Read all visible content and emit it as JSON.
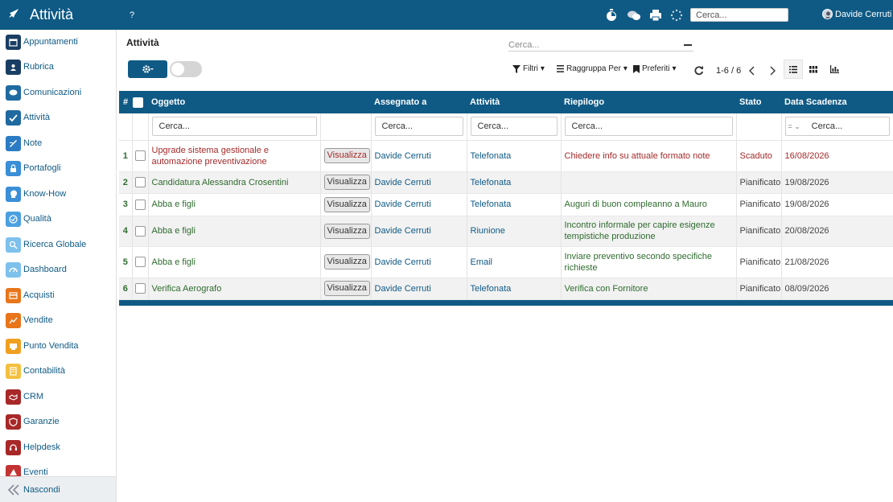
{
  "header": {
    "title": "Attività",
    "help": "?",
    "search_placeholder": "Cerca...",
    "user": "Davide Cerruti"
  },
  "sidebar": {
    "items": [
      {
        "label": "Appuntamenti",
        "icon": "calendar-icon",
        "color": "#1a3e63"
      },
      {
        "label": "Rubrica",
        "icon": "contact-icon",
        "color": "#1a3e63"
      },
      {
        "label": "Comunicazioni",
        "icon": "chat-icon",
        "color": "#1f6aa0"
      },
      {
        "label": "Attività",
        "icon": "check-icon",
        "color": "#1f6aa0"
      },
      {
        "label": "Note",
        "icon": "note-icon",
        "color": "#2b7cc4"
      },
      {
        "label": "Portafogli",
        "icon": "lock-icon",
        "color": "#3a8fd6"
      },
      {
        "label": "Know-How",
        "icon": "head-icon",
        "color": "#3a8fd6"
      },
      {
        "label": "Qualità",
        "icon": "quality-icon",
        "color": "#4aa0e0"
      },
      {
        "label": "Ricerca Globale",
        "icon": "search-icon",
        "color": "#7ec1ec"
      },
      {
        "label": "Dashboard",
        "icon": "dashboard-icon",
        "color": "#7ec1ec"
      },
      {
        "label": "Acquisti",
        "icon": "purchase-icon",
        "color": "#e8751a"
      },
      {
        "label": "Vendite",
        "icon": "sales-icon",
        "color": "#e8751a"
      },
      {
        "label": "Punto Vendita",
        "icon": "pos-icon",
        "color": "#f0a020"
      },
      {
        "label": "Contabilità",
        "icon": "accounting-icon",
        "color": "#f4c040"
      },
      {
        "label": "CRM",
        "icon": "crm-icon",
        "color": "#a82828"
      },
      {
        "label": "Garanzie",
        "icon": "shield-icon",
        "color": "#a82828"
      },
      {
        "label": "Helpdesk",
        "icon": "headset-icon",
        "color": "#a82828"
      },
      {
        "label": "Eventi",
        "icon": "event-icon",
        "color": "#c33333"
      }
    ],
    "footer_label": "Nascondi"
  },
  "main": {
    "title": "Attività",
    "search_placeholder": "Cerca...",
    "filters_label": "Filtri",
    "group_label": "Raggruppa Per",
    "favorites_label": "Preferiti",
    "pager": "1-6 / 6"
  },
  "table": {
    "headers": {
      "index": "#",
      "oggetto": "Oggetto",
      "assegnato": "Assegnato a",
      "attivita": "Attività",
      "riepilogo": "Riepilogo",
      "stato": "Stato",
      "scadenza": "Data Scadenza"
    },
    "filter_placeholder": "Cerca...",
    "date_operator": "=",
    "view_label": "Visualizza",
    "rows": [
      {
        "n": "1",
        "oggetto": "Upgrade sistema gestionale e automazione preventivazione",
        "assegnato": "Davide Cerruti",
        "attivita": "Telefonata",
        "riepilogo": "Chiedere info su attuale formato note",
        "stato": "Scaduto",
        "scadenza": "16/08/2026",
        "overdue": true
      },
      {
        "n": "2",
        "oggetto": "Candidatura Alessandra Crosentini",
        "assegnato": "Davide Cerruti",
        "attivita": "Telefonata",
        "riepilogo": "",
        "stato": "Pianificato",
        "scadenza": "19/08/2026",
        "overdue": false
      },
      {
        "n": "3",
        "oggetto": "Abba e figli",
        "assegnato": "Davide Cerruti",
        "attivita": "Telefonata",
        "riepilogo": "Auguri di buon compleanno a Mauro",
        "stato": "Pianificato",
        "scadenza": "19/08/2026",
        "overdue": false
      },
      {
        "n": "4",
        "oggetto": "Abba e figli",
        "assegnato": "Davide Cerruti",
        "attivita": "Riunione",
        "riepilogo": "Incontro informale per capire esigenze tempistiche produzione",
        "stato": "Pianificato",
        "scadenza": "20/08/2026",
        "overdue": false
      },
      {
        "n": "5",
        "oggetto": "Abba e figli",
        "assegnato": "Davide Cerruti",
        "attivita": "Email",
        "riepilogo": "Inviare preventivo secondo specifiche richieste",
        "stato": "Pianificato",
        "scadenza": "21/08/2026",
        "overdue": false
      },
      {
        "n": "6",
        "oggetto": "Verifica Aerografo",
        "assegnato": "Davide Cerruti",
        "attivita": "Telefonata",
        "riepilogo": "Verifica con Fornitore",
        "stato": "Pianificato",
        "scadenza": "08/09/2026",
        "overdue": false
      }
    ]
  }
}
